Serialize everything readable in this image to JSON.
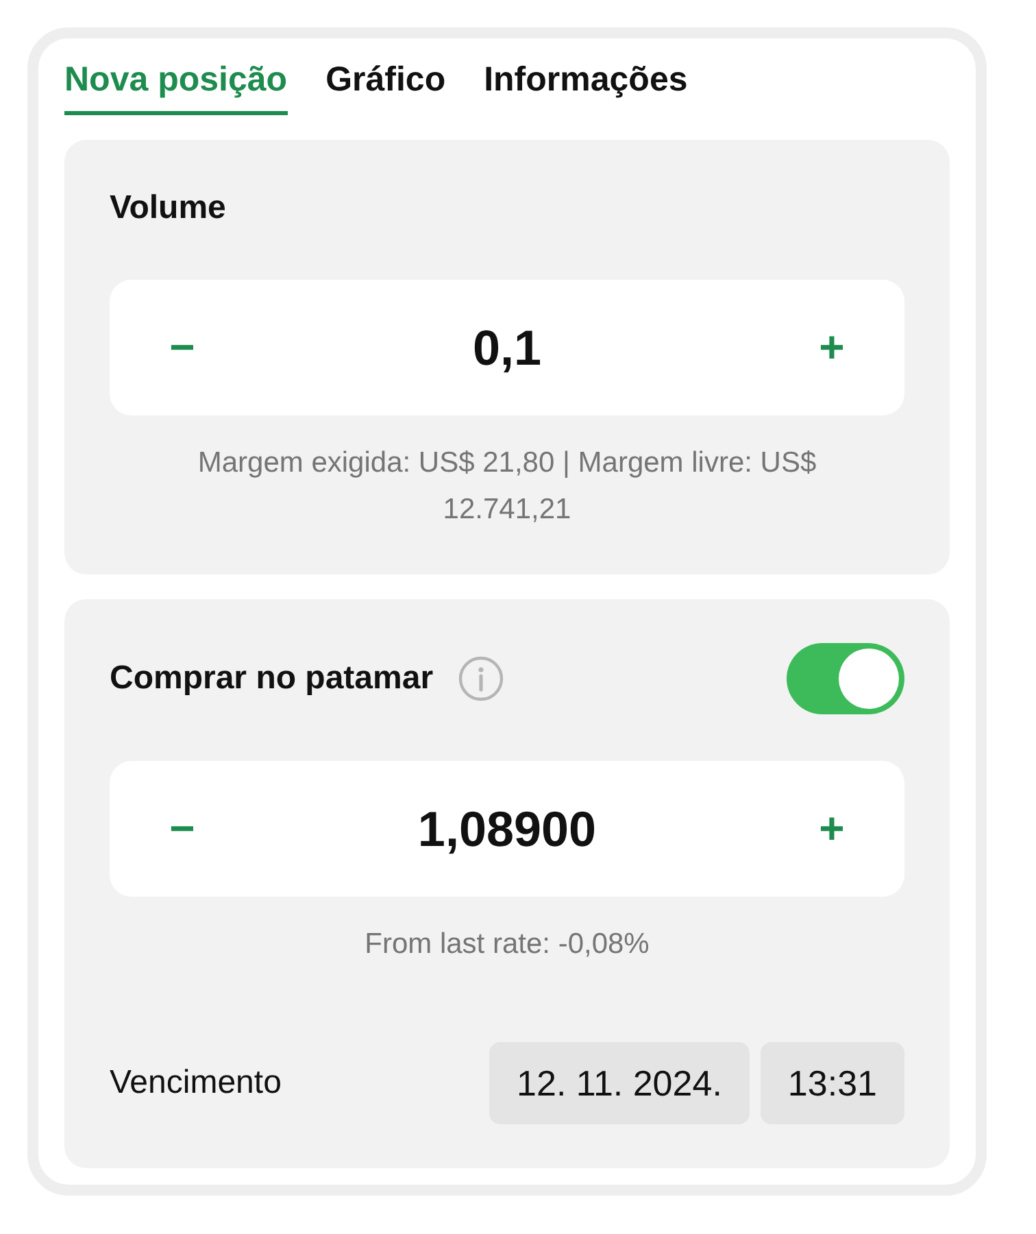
{
  "tabs": [
    {
      "label": "Nova posição",
      "selected": true
    },
    {
      "label": "Gráfico",
      "selected": false
    },
    {
      "label": "Informações",
      "selected": false
    }
  ],
  "volume": {
    "label": "Volume",
    "minus": "−",
    "value": "0,1",
    "plus": "+",
    "note": "Margem exigida: US$ 21,80 | Margem livre: US$ 12.741,21"
  },
  "limit": {
    "label": "Comprar no patamar",
    "on": true,
    "minus": "−",
    "value": "1,08900",
    "plus": "+",
    "note": "From last rate: -0,08%"
  },
  "expiry": {
    "label": "Vencimento",
    "date": "12. 11. 2024.",
    "time": "13:31"
  }
}
